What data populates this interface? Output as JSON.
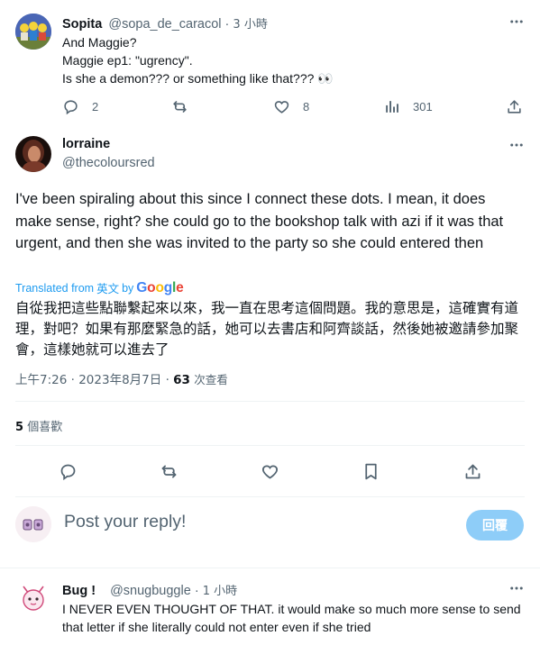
{
  "tweet1": {
    "author_name": "Sopita",
    "handle": "@sopa_de_caracol",
    "separator": "·",
    "time": "3 小時",
    "lines": [
      "And Maggie?",
      "Maggie ep1: \"ugrency\".",
      "Is she a demon??? or something like that??? 👀"
    ],
    "replies": "2",
    "likes": "8",
    "views": "301"
  },
  "main_tweet": {
    "author_name": "lorraine",
    "handle": "@thecoloursred",
    "text": "I've been spiraling about this since I connect these dots.  I mean, it does make sense, right?  she could go to the bookshop talk with azi if it was that urgent, and then she was invited to the party so she could entered then",
    "translated_prefix": "Translated from",
    "translated_lang": "英文",
    "translated_by": "by",
    "translated_brand": "Google",
    "translation": "自從我把這些點聯繫起來以來，我一直在思考這個問題。我的意思是，這確實有道理，對吧？如果有那麼緊急的話，她可以去書店和阿齊談話，然後她被邀請參加聚會，這樣她就可以進去了",
    "time": "上午7:26",
    "dot1": "·",
    "date": "2023年8月7日",
    "dot2": "·",
    "views_count": "63",
    "views_label": "次查看",
    "likes_count": "5",
    "likes_label": "個喜歡"
  },
  "reply_box": {
    "placeholder": "Post your reply!",
    "button_label": "回覆"
  },
  "tweet3": {
    "author_name": "Bug !",
    "handle": "@snugbuggle",
    "separator": "·",
    "time": "1 小時",
    "text": "I NEVER EVEN THOUGHT OF THAT. it would make so much more sense to send that letter if she literally could not enter even if she tried"
  },
  "colors": {
    "accent": "#1d9bf0",
    "reply_button_disabled": "#8ecdf8",
    "muted": "#536471",
    "text": "#0f1419"
  }
}
